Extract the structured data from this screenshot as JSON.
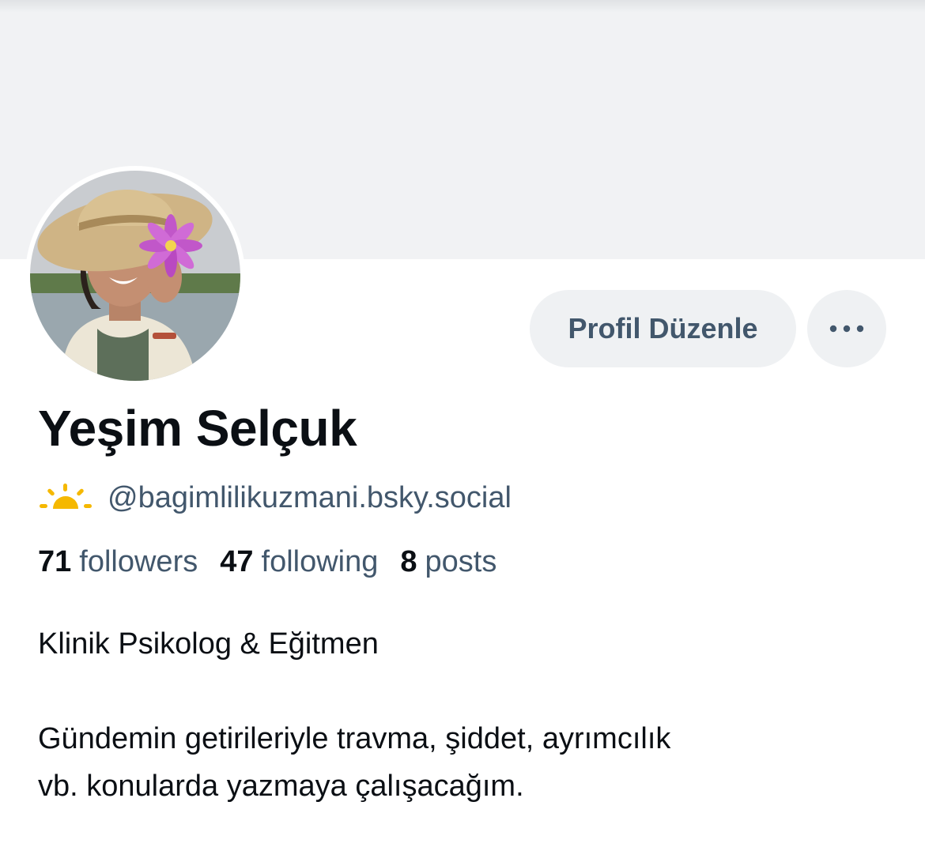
{
  "profile": {
    "display_name": "Yeşim Selçuk",
    "handle": "@bagimlilikuzmani.bsky.social",
    "badge_icon": "sun-icon",
    "avatar_icon": "profile-photo"
  },
  "actions": {
    "edit_label": "Profil Düzenle",
    "more_icon": "ellipsis-icon"
  },
  "stats": {
    "followers_count": "71",
    "followers_label": "followers",
    "following_count": "47",
    "following_label": "following",
    "posts_count": "8",
    "posts_label": "posts"
  },
  "bio": {
    "line1": "Klinik Psikolog & Eğitmen",
    "line2": "Gündemin getirileriyle travma, şiddet, ayrımcılık",
    "line3": "vb. konularda yazmaya çalışacağım."
  },
  "colors": {
    "banner": "#f1f2f4",
    "button_bg": "#eff1f3",
    "secondary_text": "#42576c",
    "primary_text": "#0b0f14",
    "sun": "#f5b800"
  }
}
